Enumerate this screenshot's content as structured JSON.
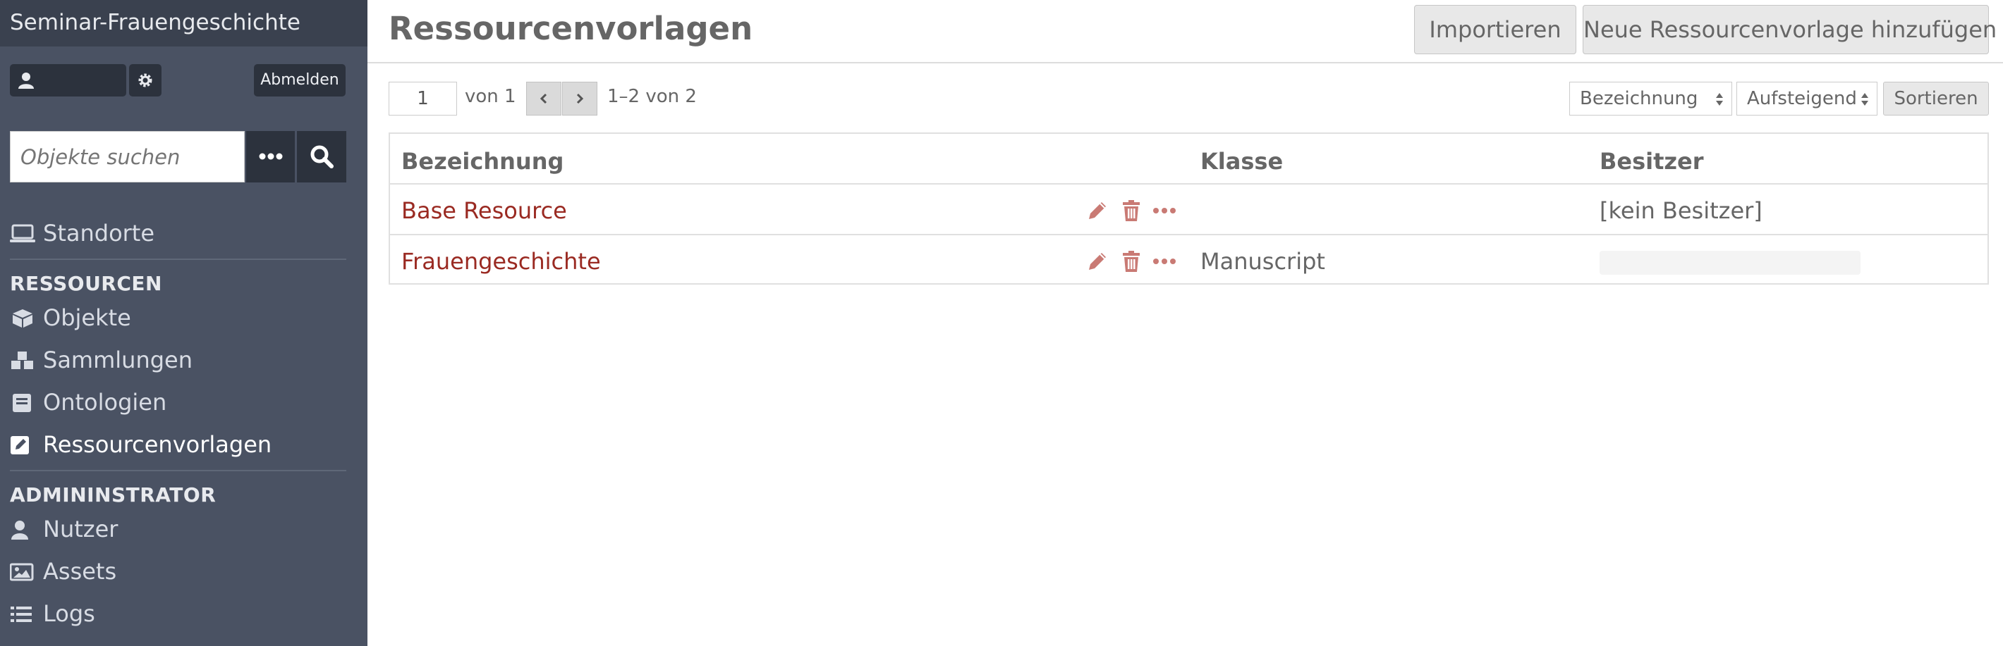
{
  "sidebar": {
    "site_title": "Seminar-Frauengeschichte",
    "logout_label": "Abmelden",
    "search_placeholder": "Objekte suchen",
    "nav_top": [
      {
        "label": "Standorte",
        "icon": "laptop-icon"
      }
    ],
    "sections": [
      {
        "heading": "RESSOURCEN",
        "items": [
          {
            "label": "Objekte",
            "icon": "cube-icon"
          },
          {
            "label": "Sammlungen",
            "icon": "cubes-icon"
          },
          {
            "label": "Ontologien",
            "icon": "book-icon"
          },
          {
            "label": "Ressourcenvorlagen",
            "icon": "pencil-square-icon",
            "active": true
          }
        ]
      },
      {
        "heading": "ADMININSTRATOR",
        "items": [
          {
            "label": "Nutzer",
            "icon": "user-icon"
          },
          {
            "label": "Assets",
            "icon": "image-icon"
          },
          {
            "label": "Logs",
            "icon": "list-icon"
          }
        ]
      }
    ]
  },
  "header": {
    "title": "Ressourcenvorlagen",
    "import_label": "Importieren",
    "add_label": "Neue Ressourcenvorlage hinzufügen"
  },
  "pagination": {
    "page": "1",
    "of_label": "von 1",
    "range_label": "1–2 von 2"
  },
  "sorting": {
    "sort_by": "Bezeichnung",
    "order": "Aufsteigend",
    "button_label": "Sortieren"
  },
  "table": {
    "columns": [
      "Bezeichnung",
      "Klasse",
      "Besitzer"
    ],
    "rows": [
      {
        "label": "Base Resource",
        "class": "",
        "owner": "[kein Besitzer]"
      },
      {
        "label": "Frauengeschichte",
        "class": "Manuscript",
        "owner": ""
      }
    ]
  },
  "colors": {
    "sidebar_bg": "#4a5263",
    "link": "#9a2a22",
    "action_icon": "#c97a74"
  }
}
